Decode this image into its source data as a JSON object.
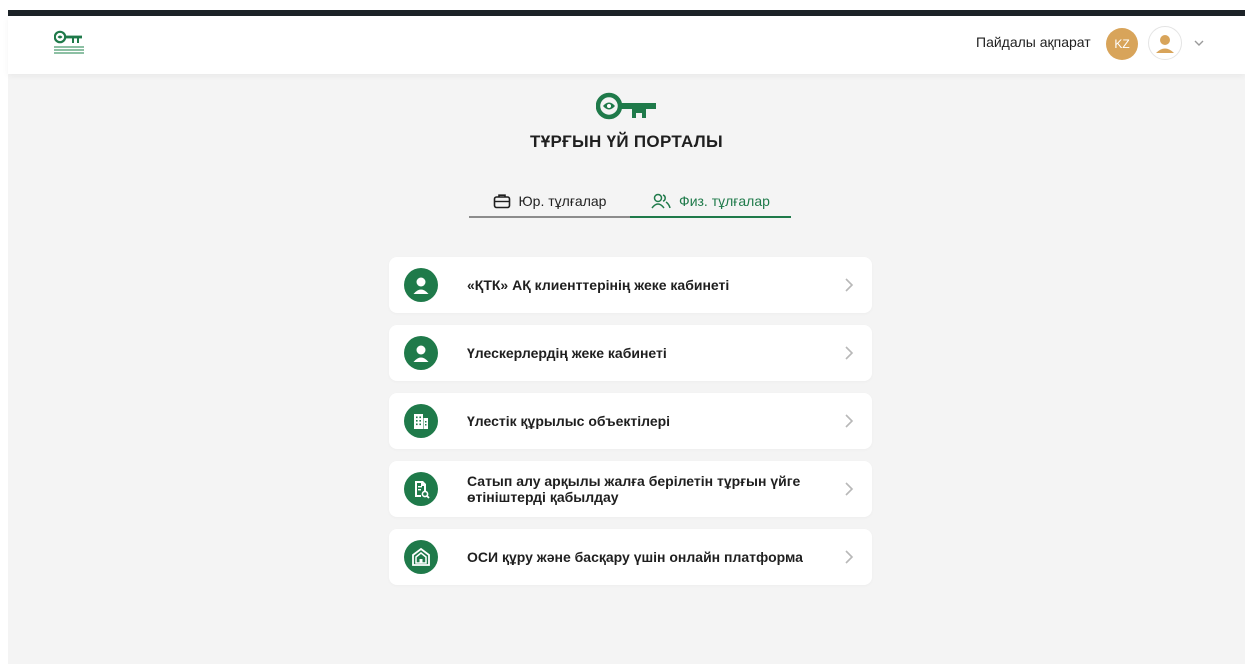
{
  "header": {
    "useful_info": "Пайдалы ақпарат",
    "lang": "KZ"
  },
  "page": {
    "title": "ТҰРҒЫН ҮЙ ПОРТАЛЫ"
  },
  "tabs": [
    {
      "label": "Юр. тұлғалар",
      "icon": "briefcase-icon",
      "active": false
    },
    {
      "label": "Физ. тұлғалар",
      "icon": "users-icon",
      "active": true
    }
  ],
  "cards": [
    {
      "label": "«ҚТК» АҚ клиенттерінің жеке кабинеті",
      "icon": "user-icon"
    },
    {
      "label": "Үлескерлердің жеке кабинеті",
      "icon": "user-icon"
    },
    {
      "label": "Үлестік құрылыс объектілері",
      "icon": "building-icon"
    },
    {
      "label": "Сатып алу арқылы жалға берілетін тұрғын үйге өтініштерді қабылдау",
      "icon": "document-search-icon"
    },
    {
      "label": "ОСИ құру және басқару үшін онлайн платформа",
      "icon": "house-icon"
    }
  ],
  "colors": {
    "brand_green": "#1f7a4a",
    "lang_badge": "#d8a45a",
    "background": "#f4f4f4"
  }
}
